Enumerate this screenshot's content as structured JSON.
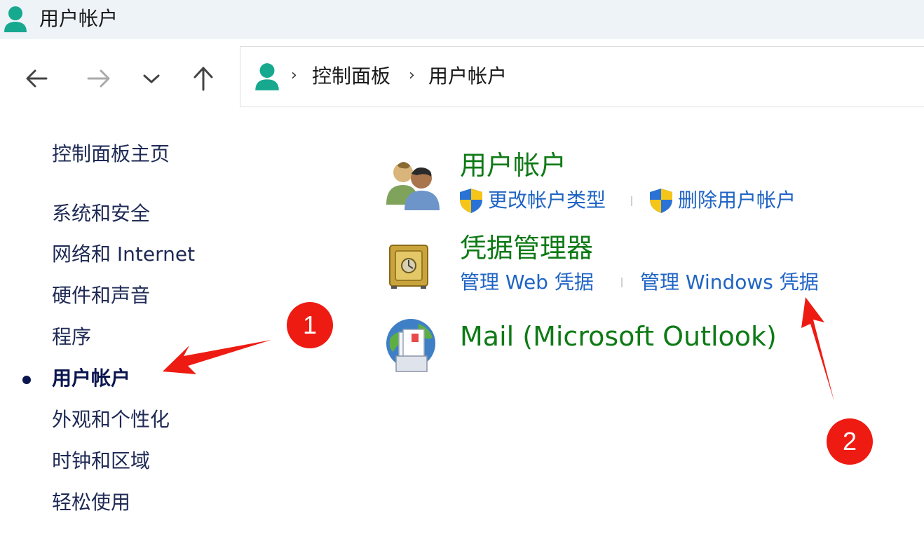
{
  "window": {
    "title": "用户帐户"
  },
  "nav": {
    "back": "back-arrow",
    "forward": "forward-arrow",
    "recent": "chevron-down",
    "up": "up-arrow"
  },
  "breadcrumb": {
    "items": [
      "控制面板",
      "用户帐户"
    ],
    "separator": "›"
  },
  "sidebar": {
    "home": "控制面板主页",
    "items": [
      "系统和安全",
      "网络和 Internet",
      "硬件和声音",
      "程序",
      "用户帐户",
      "外观和个性化",
      "时钟和区域",
      "轻松使用"
    ],
    "active_index": 4
  },
  "categories": {
    "user_accounts": {
      "title": "用户帐户",
      "links": [
        "更改帐户类型",
        "删除用户帐户"
      ]
    },
    "credential_manager": {
      "title": "凭据管理器",
      "links": [
        "管理 Web 凭据",
        "管理 Windows 凭据"
      ]
    },
    "mail": {
      "title": "Mail (Microsoft Outlook)"
    }
  },
  "annotations": {
    "first": "1",
    "second": "2"
  },
  "colors": {
    "category_title": "#0e7a16",
    "link": "#1f64c4",
    "annotation": "#ee1b12",
    "titlebar": "#eef3f8"
  }
}
